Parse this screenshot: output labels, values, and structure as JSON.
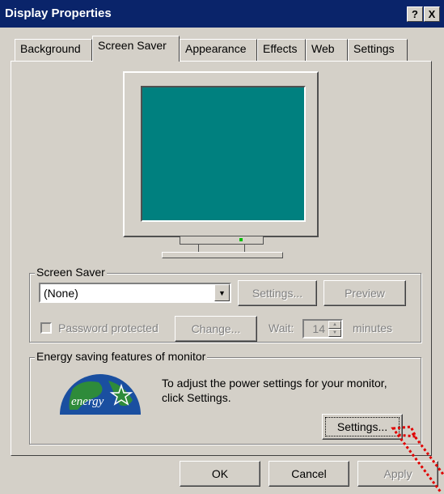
{
  "window": {
    "title": "Display Properties",
    "help": "?",
    "close": "X"
  },
  "tabs": [
    {
      "label": "Background"
    },
    {
      "label": "Screen Saver"
    },
    {
      "label": "Appearance"
    },
    {
      "label": "Effects"
    },
    {
      "label": "Web"
    },
    {
      "label": "Settings"
    }
  ],
  "active_tab": "Screen Saver",
  "screen_saver": {
    "group_label": "Screen Saver",
    "selected": "(None)",
    "settings_label": "Settings...",
    "preview_label": "Preview",
    "password_label": "Password protected",
    "change_label": "Change...",
    "wait_label": "Wait:",
    "wait_value": "14",
    "minutes_label": "minutes"
  },
  "energy": {
    "group_label": "Energy saving features of monitor",
    "note": "To adjust the power settings for your monitor, click Settings.",
    "settings_label": "Settings...",
    "logo_text": "energy"
  },
  "footer": {
    "ok": "OK",
    "cancel": "Cancel",
    "apply": "Apply"
  },
  "colors": {
    "title_bar": "#0a246a",
    "screen": "#00807f",
    "face": "#d4d0c8",
    "annotation": "#e00000"
  }
}
